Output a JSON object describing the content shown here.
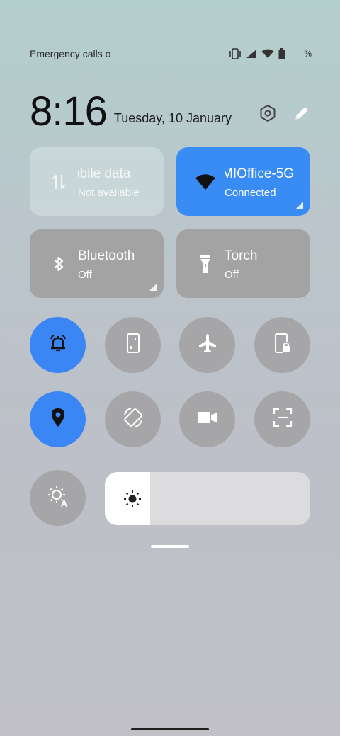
{
  "status_bar": {
    "left_text": "Emergency calls o",
    "battery_text": "%",
    "icons": [
      "vibrate-icon",
      "signal-icon",
      "wifi-icon",
      "battery-icon"
    ]
  },
  "header": {
    "time": "8:16",
    "date": "Tuesday, 10 January",
    "actions": [
      "settings-icon",
      "edit-icon"
    ]
  },
  "tiles": {
    "mobile_data": {
      "title": "obile data",
      "subtitle": "Not available",
      "icon": "mobile-data-icon",
      "state": "disabled"
    },
    "wifi": {
      "title": "MIOffice-5G",
      "subtitle": "Connected",
      "icon": "wifi-icon",
      "state": "on"
    },
    "bluetooth": {
      "title": "Bluetooth",
      "subtitle": "Off",
      "icon": "bluetooth-icon",
      "state": "off"
    },
    "torch": {
      "title": "Torch",
      "subtitle": "Off",
      "icon": "flashlight-icon",
      "state": "off"
    }
  },
  "toggles": [
    {
      "name": "alarm-bell-icon",
      "state": "on"
    },
    {
      "name": "screen-mirror-icon",
      "state": "off"
    },
    {
      "name": "airplane-icon",
      "state": "off"
    },
    {
      "name": "lock-screen-icon",
      "state": "off"
    },
    {
      "name": "location-icon",
      "state": "on"
    },
    {
      "name": "auto-rotate-icon",
      "state": "off"
    },
    {
      "name": "screen-record-icon",
      "state": "off"
    },
    {
      "name": "scan-icon",
      "state": "off"
    }
  ],
  "brightness": {
    "level": 0.22,
    "auto_icon": "auto-brightness-icon"
  },
  "colors": {
    "accent": "#3a86f4",
    "tile_off": "#a3a3a4"
  }
}
